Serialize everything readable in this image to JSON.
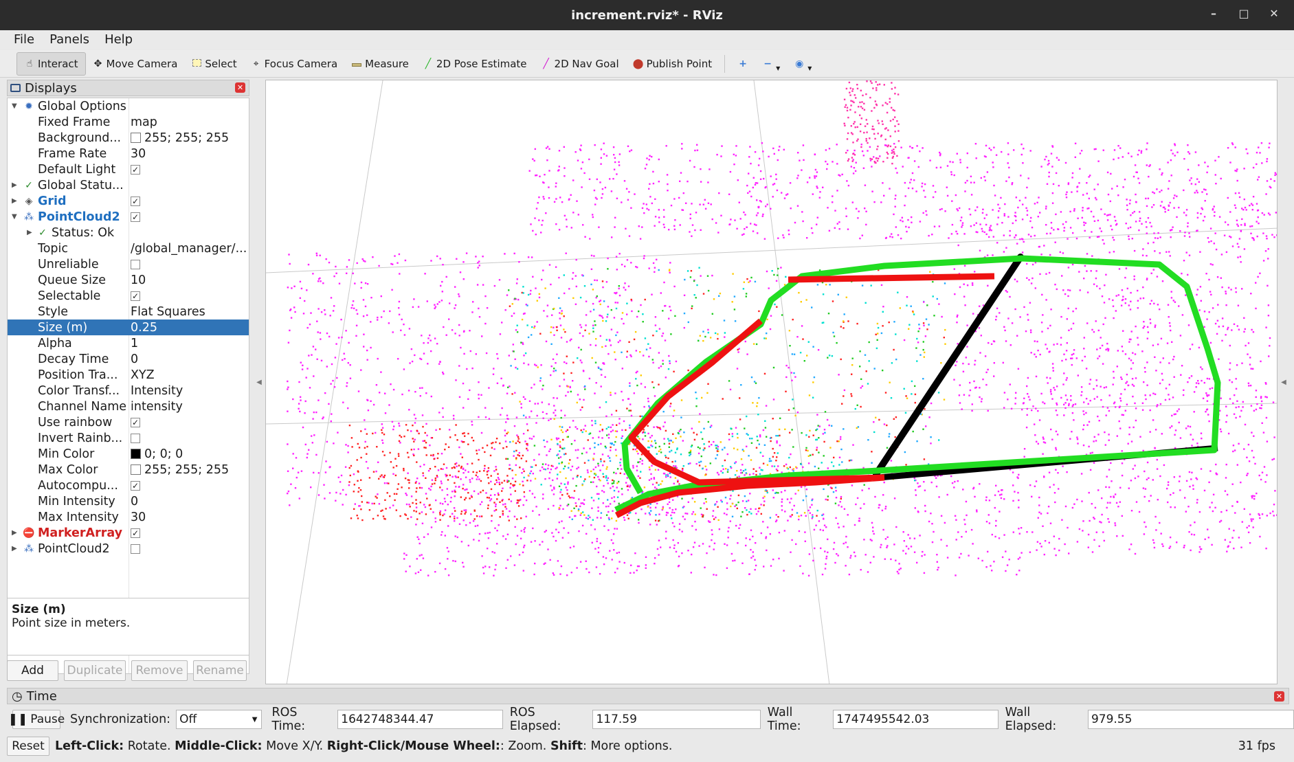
{
  "window": {
    "title": "increment.rviz* - RViz",
    "buttons": [
      "–",
      "□",
      "✕"
    ]
  },
  "menu": {
    "file": "File",
    "panels": "Panels",
    "help": "Help"
  },
  "toolbar": {
    "interact": "Interact",
    "move_camera": "Move Camera",
    "select": "Select",
    "focus_camera": "Focus Camera",
    "measure": "Measure",
    "pose_estimate": "2D Pose Estimate",
    "nav_goal": "2D Nav Goal",
    "publish_point": "Publish Point"
  },
  "displays": {
    "title": "Displays",
    "global_options": "Global Options",
    "fixed_frame_label": "Fixed Frame",
    "fixed_frame_value": "map",
    "background_label": "Background...",
    "background_value": "255; 255; 255",
    "frame_rate_label": "Frame Rate",
    "frame_rate_value": "30",
    "default_light_label": "Default Light",
    "global_status": "Global Statu...",
    "grid": "Grid",
    "pointcloud2": "PointCloud2",
    "status_ok": "Status: Ok",
    "topic_label": "Topic",
    "topic_value": "/global_manager/...",
    "unreliable_label": "Unreliable",
    "queue_size_label": "Queue Size",
    "queue_size_value": "10",
    "selectable_label": "Selectable",
    "style_label": "Style",
    "style_value": "Flat Squares",
    "size_label": "Size (m)",
    "size_value": "0.25",
    "alpha_label": "Alpha",
    "alpha_value": "1",
    "decay_label": "Decay Time",
    "decay_value": "0",
    "position_label": "Position Tra...",
    "position_value": "XYZ",
    "color_transformer_label": "Color Transf...",
    "color_transformer_value": "Intensity",
    "channel_label": "Channel Name",
    "channel_value": "intensity",
    "use_rainbow_label": "Use rainbow",
    "invert_rainbow_label": "Invert Rainb...",
    "min_color_label": "Min Color",
    "min_color_value": "0; 0; 0",
    "max_color_label": "Max Color",
    "max_color_value": "255; 255; 255",
    "autocompute_label": "Autocompu...",
    "min_intensity_label": "Min Intensity",
    "min_intensity_value": "0",
    "max_intensity_label": "Max Intensity",
    "max_intensity_value": "30",
    "marker_array": "MarkerArray",
    "pointcloud2_b": "PointCloud2"
  },
  "description": {
    "title": "Size (m)",
    "text": "Point size in meters."
  },
  "buttons": {
    "add": "Add",
    "duplicate": "Duplicate",
    "remove": "Remove",
    "rename": "Rename"
  },
  "time": {
    "title": "Time",
    "pause": "Pause",
    "sync_label": "Synchronization:",
    "sync_value": "Off",
    "ros_time_label": "ROS Time:",
    "ros_time_value": "1642748344.47",
    "ros_elapsed_label": "ROS Elapsed:",
    "ros_elapsed_value": "117.59",
    "wall_time_label": "Wall Time:",
    "wall_time_value": "1747495542.03",
    "wall_elapsed_label": "Wall Elapsed:",
    "wall_elapsed_value": "979.55"
  },
  "status": {
    "reset": "Reset",
    "left_click": "Left-Click:",
    "rotate": " Rotate. ",
    "middle_click": "Middle-Click:",
    "move": " Move X/Y. ",
    "right_click": "Right-Click/Mouse Wheel:",
    "zoom": ": Zoom. ",
    "shift": "Shift",
    "more": ": More options.",
    "fps": "31 fps"
  },
  "colors": {
    "selection": "#3074b7",
    "trajectory_green": "#22dd22",
    "trajectory_red": "#ee1111",
    "cloud_magenta": "#ff1aff"
  }
}
